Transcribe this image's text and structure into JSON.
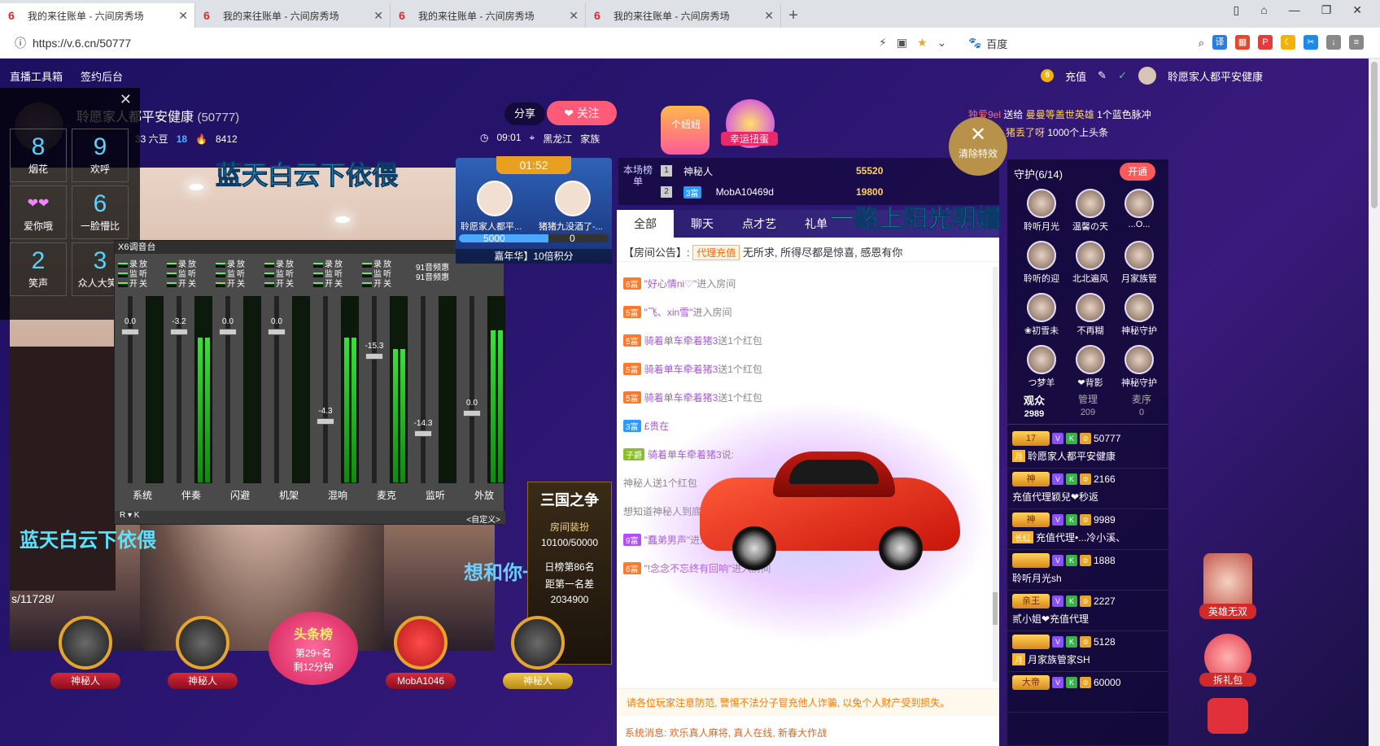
{
  "browser": {
    "tabs": [
      {
        "title": "我的来往账单 - 六间房秀场"
      },
      {
        "title": "我的来往账单 - 六间房秀场"
      },
      {
        "title": "我的来往账单 - 六间房秀场"
      },
      {
        "title": "我的来往账单 - 六间房秀场"
      }
    ],
    "url": "https://v.6.cn/50777",
    "search_engine": "百度"
  },
  "topnav": {
    "tools": "直播工具箱",
    "backend": "签约后台",
    "recharge": "充值",
    "username": "聆愿家人都平安健康"
  },
  "fxpanel": {
    "items": [
      {
        "num": "8",
        "label": "烟花"
      },
      {
        "num": "9",
        "label": "欢呼"
      },
      {
        "num": "",
        "emoji": "爱你哦",
        "label": "爱你哦"
      },
      {
        "num": "6",
        "label": "一脸懵比"
      },
      {
        "num": "2",
        "label": "笑声"
      },
      {
        "num": "3",
        "label": "众人大笑1"
      }
    ]
  },
  "anchor": {
    "name": "聆愿家人都平安健康",
    "id": "(50777)",
    "beans": "33 六豆",
    "level": "18",
    "fans": "8412",
    "share": "分享",
    "follow": "关注",
    "time": "09:01",
    "location": "黑龙江",
    "family": "家族"
  },
  "video": {
    "caption_top": "蓝天白云下依偎",
    "caption_bottom": "蓝天白云下依偎",
    "caption_right": "想和你一",
    "url_fragment": "s/11728/"
  },
  "mixer": {
    "title": "X6调音台",
    "freq1": "91音频惠",
    "freq2": "91音频惠",
    "footer": "<自定义>",
    "channels": [
      {
        "name": "系统",
        "value": "0.0"
      },
      {
        "name": "伴奏",
        "value": "-3.2"
      },
      {
        "name": "闪避",
        "value": "0.0"
      },
      {
        "name": "机架",
        "value": "0.0"
      },
      {
        "name": "混响",
        "value": "-4.3"
      },
      {
        "name": "麦克",
        "value": "-15.3"
      },
      {
        "name": "监听",
        "value": "-14.3"
      },
      {
        "name": "外放",
        "value": "0.0"
      }
    ],
    "switch_labels": [
      "录",
      "放",
      "监",
      "听",
      "开",
      "关"
    ],
    "scale": [
      "0",
      "6",
      "12",
      "24",
      "36",
      "48",
      "60",
      "72"
    ]
  },
  "pk": {
    "timer": "01:52",
    "left_name": "聆愿家人都平...",
    "right_name": "猪猪九没酒了-...",
    "left_score": "5000",
    "right_score": "0",
    "promo": "嘉年华】10倍积分"
  },
  "sanguo": {
    "title": "三国之争",
    "label": "房间装扮",
    "progress": "10100/50000",
    "rank": "日榜第86名",
    "gap_label": "距第一名差",
    "gap": "2034900"
  },
  "seats": [
    {
      "label": "神秘人"
    },
    {
      "label": "神秘人"
    },
    {
      "label": "MobA1046"
    },
    {
      "label": "神秘人"
    }
  ],
  "toplist": {
    "title": "头条榜",
    "rank": "第29+名",
    "time": "剩12分钟"
  },
  "gifts": [
    {
      "label": "个妞妞"
    },
    {
      "label": "幸运扭蛋"
    }
  ],
  "clear_fx": "清除特效",
  "big_caption": "一路上阳光明媚",
  "marquee": [
    {
      "a": "独爱9el",
      "b": "送给",
      "c": "曼曼等盖世英雄",
      "d": "1个蓝色脉冲"
    },
    {
      "a": "",
      "b": "给",
      "c": "恩熙: 猪丢了呀",
      "d": "1000个上头条"
    }
  ],
  "rank": {
    "header": "本场榜单",
    "rows": [
      {
        "n": "1",
        "name": "神秘人",
        "score": "55520"
      },
      {
        "n": "2",
        "lv": "3富",
        "name": "MobA10469d",
        "score": "19800"
      }
    ]
  },
  "chat": {
    "tabs": [
      "全部",
      "聊天",
      "点才艺",
      "礼单"
    ],
    "notice_prefix": "【房间公告】:",
    "notice_btn": "代理充值",
    "notice_text": "无所求, 所得尽都是惊喜, 感恩有你",
    "messages": [
      {
        "lv": "6富",
        "user": "\"好心情ni♡\"",
        "text": "进入房间"
      },
      {
        "lv": "5富",
        "user": "\"飞、xin雪\"",
        "text": "进入房间"
      },
      {
        "lv": "5富",
        "user": "骑着单车牵着猪3",
        "text": "送1个红包"
      },
      {
        "lv": "5富",
        "user": "骑着单车牵着猪3",
        "text": "送1个红包"
      },
      {
        "lv": "5富",
        "user": "骑着单车牵着猪3",
        "text": "送1个红包"
      },
      {
        "lv": "3富",
        "user": "£贵在",
        "text": ""
      },
      {
        "lv": "子爵",
        "user": "骑着单车牵着猪3",
        "text": "说:"
      },
      {
        "lv": "",
        "user": "神秘人",
        "text": "送1个红包"
      },
      {
        "lv": "",
        "user": "想知道神秘人到底是谁? 去\"管理中心-神秘人\"查看吧, 记得要保密哦!",
        "text": ""
      },
      {
        "lv": "9富",
        "user": "\"蠢弟男声\"",
        "text": "进入房间"
      },
      {
        "lv": "6富",
        "user": "\"!念念不忘终有回响\"",
        "text": "进入房间"
      }
    ],
    "warning": "请各位玩家注意防范, 警惕不法分子冒充他人诈骗, 以免个人财产受到损失。",
    "system": "系统消息: 欢乐真人麻将, 真人在线, 新春大作战"
  },
  "guard": {
    "title": "守护(6/14)",
    "open": "开通",
    "items": [
      "聆听月光",
      "温馨の天",
      "...O...",
      "聆听的迎",
      "北北遍风",
      "月家族管",
      "❀初雪未",
      "不再糊",
      "神秘守护",
      "つ梦羊",
      "❤背影",
      "神秘守护"
    ]
  },
  "audience": {
    "tabs": [
      {
        "label": "观众",
        "count": "2989"
      },
      {
        "label": "管理",
        "count": "209"
      },
      {
        "label": "麦序",
        "count": "0"
      }
    ],
    "list": [
      {
        "lv": "17",
        "num": "50777",
        "badge": "月",
        "name": "聆愿家人都平安健康"
      },
      {
        "lv": "神",
        "num": "2166",
        "badge": "",
        "name": "充值代理颖兒❤秒返"
      },
      {
        "lv": "神",
        "num": "9989",
        "badge": "长红",
        "name": "充值代理•...冷小溪、"
      },
      {
        "lv": "",
        "num": "1888",
        "badge": "",
        "name": "聆听月光sh"
      },
      {
        "lv": "亲王",
        "num": "2227",
        "badge": "",
        "name": "贰小姐❤充值代理"
      },
      {
        "lv": "",
        "num": "5128",
        "badge": "月",
        "name": "月家族管家SH"
      },
      {
        "lv": "大帝",
        "num": "60000",
        "badge": "",
        "name": ""
      }
    ]
  },
  "side_ads": {
    "a1": "英雄无双",
    "a2": "拆礼包"
  }
}
